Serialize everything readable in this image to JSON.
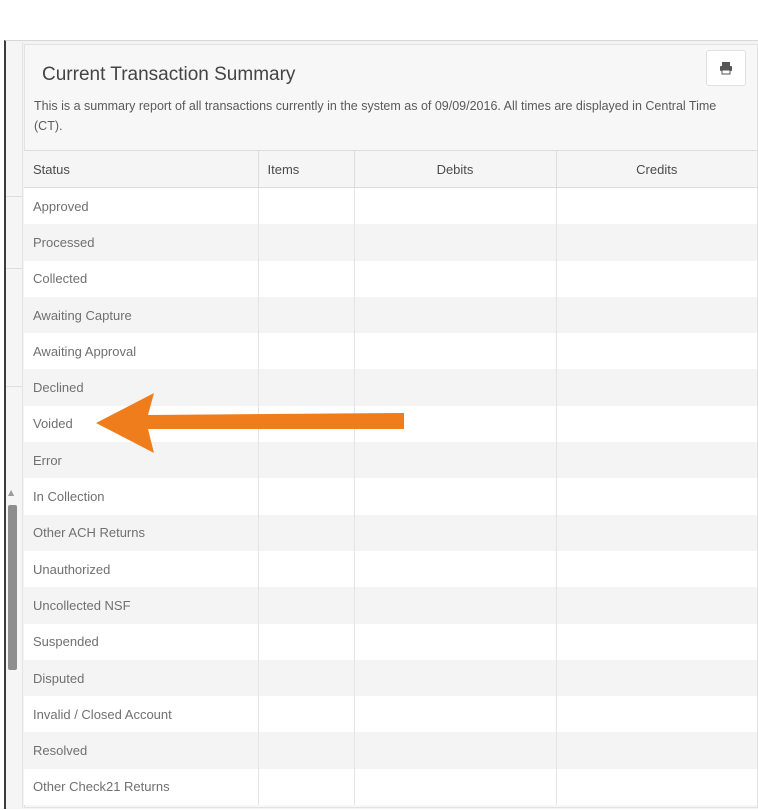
{
  "report": {
    "title": "Current Transaction Summary",
    "description": "This is a summary report of all transactions currently in the system as of 09/09/2016. All times are displayed in Central Time (CT)."
  },
  "toolbar": {
    "print_icon": "printer-icon"
  },
  "annotation": {
    "arrow_icon": "arrow-left-icon",
    "arrow_color": "#f07d1c"
  },
  "table": {
    "headers": {
      "status": "Status",
      "items": "Items",
      "debits": "Debits",
      "credits": "Credits"
    },
    "rows": [
      {
        "status": "Approved",
        "items": "",
        "debits": "",
        "credits": ""
      },
      {
        "status": "Processed",
        "items": "",
        "debits": "",
        "credits": ""
      },
      {
        "status": "Collected",
        "items": "",
        "debits": "",
        "credits": ""
      },
      {
        "status": "Awaiting Capture",
        "items": "",
        "debits": "",
        "credits": ""
      },
      {
        "status": "Awaiting Approval",
        "items": "",
        "debits": "",
        "credits": ""
      },
      {
        "status": "Declined",
        "items": "",
        "debits": "",
        "credits": ""
      },
      {
        "status": "Voided",
        "items": "",
        "debits": "",
        "credits": ""
      },
      {
        "status": "Error",
        "items": "",
        "debits": "",
        "credits": ""
      },
      {
        "status": "In Collection",
        "items": "",
        "debits": "",
        "credits": ""
      },
      {
        "status": "Other ACH Returns",
        "items": "",
        "debits": "",
        "credits": ""
      },
      {
        "status": "Unauthorized",
        "items": "",
        "debits": "",
        "credits": ""
      },
      {
        "status": "Uncollected NSF",
        "items": "",
        "debits": "",
        "credits": ""
      },
      {
        "status": "Suspended",
        "items": "",
        "debits": "",
        "credits": ""
      },
      {
        "status": "Disputed",
        "items": "",
        "debits": "",
        "credits": ""
      },
      {
        "status": "Invalid / Closed Account",
        "items": "",
        "debits": "",
        "credits": ""
      },
      {
        "status": "Resolved",
        "items": "",
        "debits": "",
        "credits": ""
      },
      {
        "status": "Other Check21 Returns",
        "items": "",
        "debits": "",
        "credits": ""
      }
    ]
  }
}
